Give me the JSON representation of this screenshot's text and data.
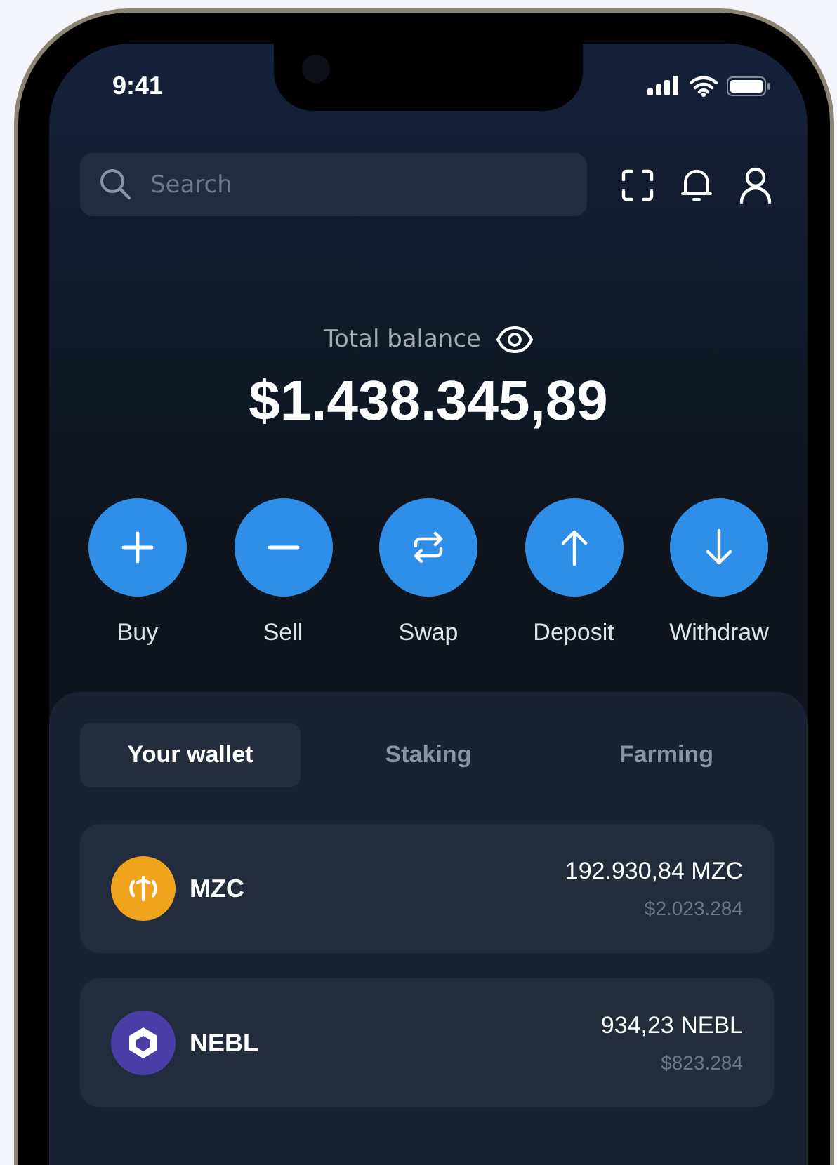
{
  "status_bar": {
    "time": "9:41"
  },
  "search": {
    "placeholder": "Search"
  },
  "balance": {
    "label": "Total balance",
    "amount": "$1.438.345,89"
  },
  "actions": [
    {
      "label": "Buy",
      "kind": "plus"
    },
    {
      "label": "Sell",
      "kind": "minus"
    },
    {
      "label": "Swap",
      "kind": "swap"
    },
    {
      "label": "Deposit",
      "kind": "up"
    },
    {
      "label": "Withdraw",
      "kind": "down"
    }
  ],
  "tabs": [
    {
      "label": "Your wallet",
      "selected": true
    },
    {
      "label": "Staking",
      "selected": false
    },
    {
      "label": "Farming",
      "selected": false
    }
  ],
  "assets": [
    {
      "symbol": "MZC",
      "amount": "192.930,84 MZC",
      "value": "$2.023.284",
      "color": "#f0a31c"
    },
    {
      "symbol": "NEBL",
      "amount": "934,23 NEBL",
      "value": "$823.284",
      "color": "#4b3ea6"
    }
  ]
}
